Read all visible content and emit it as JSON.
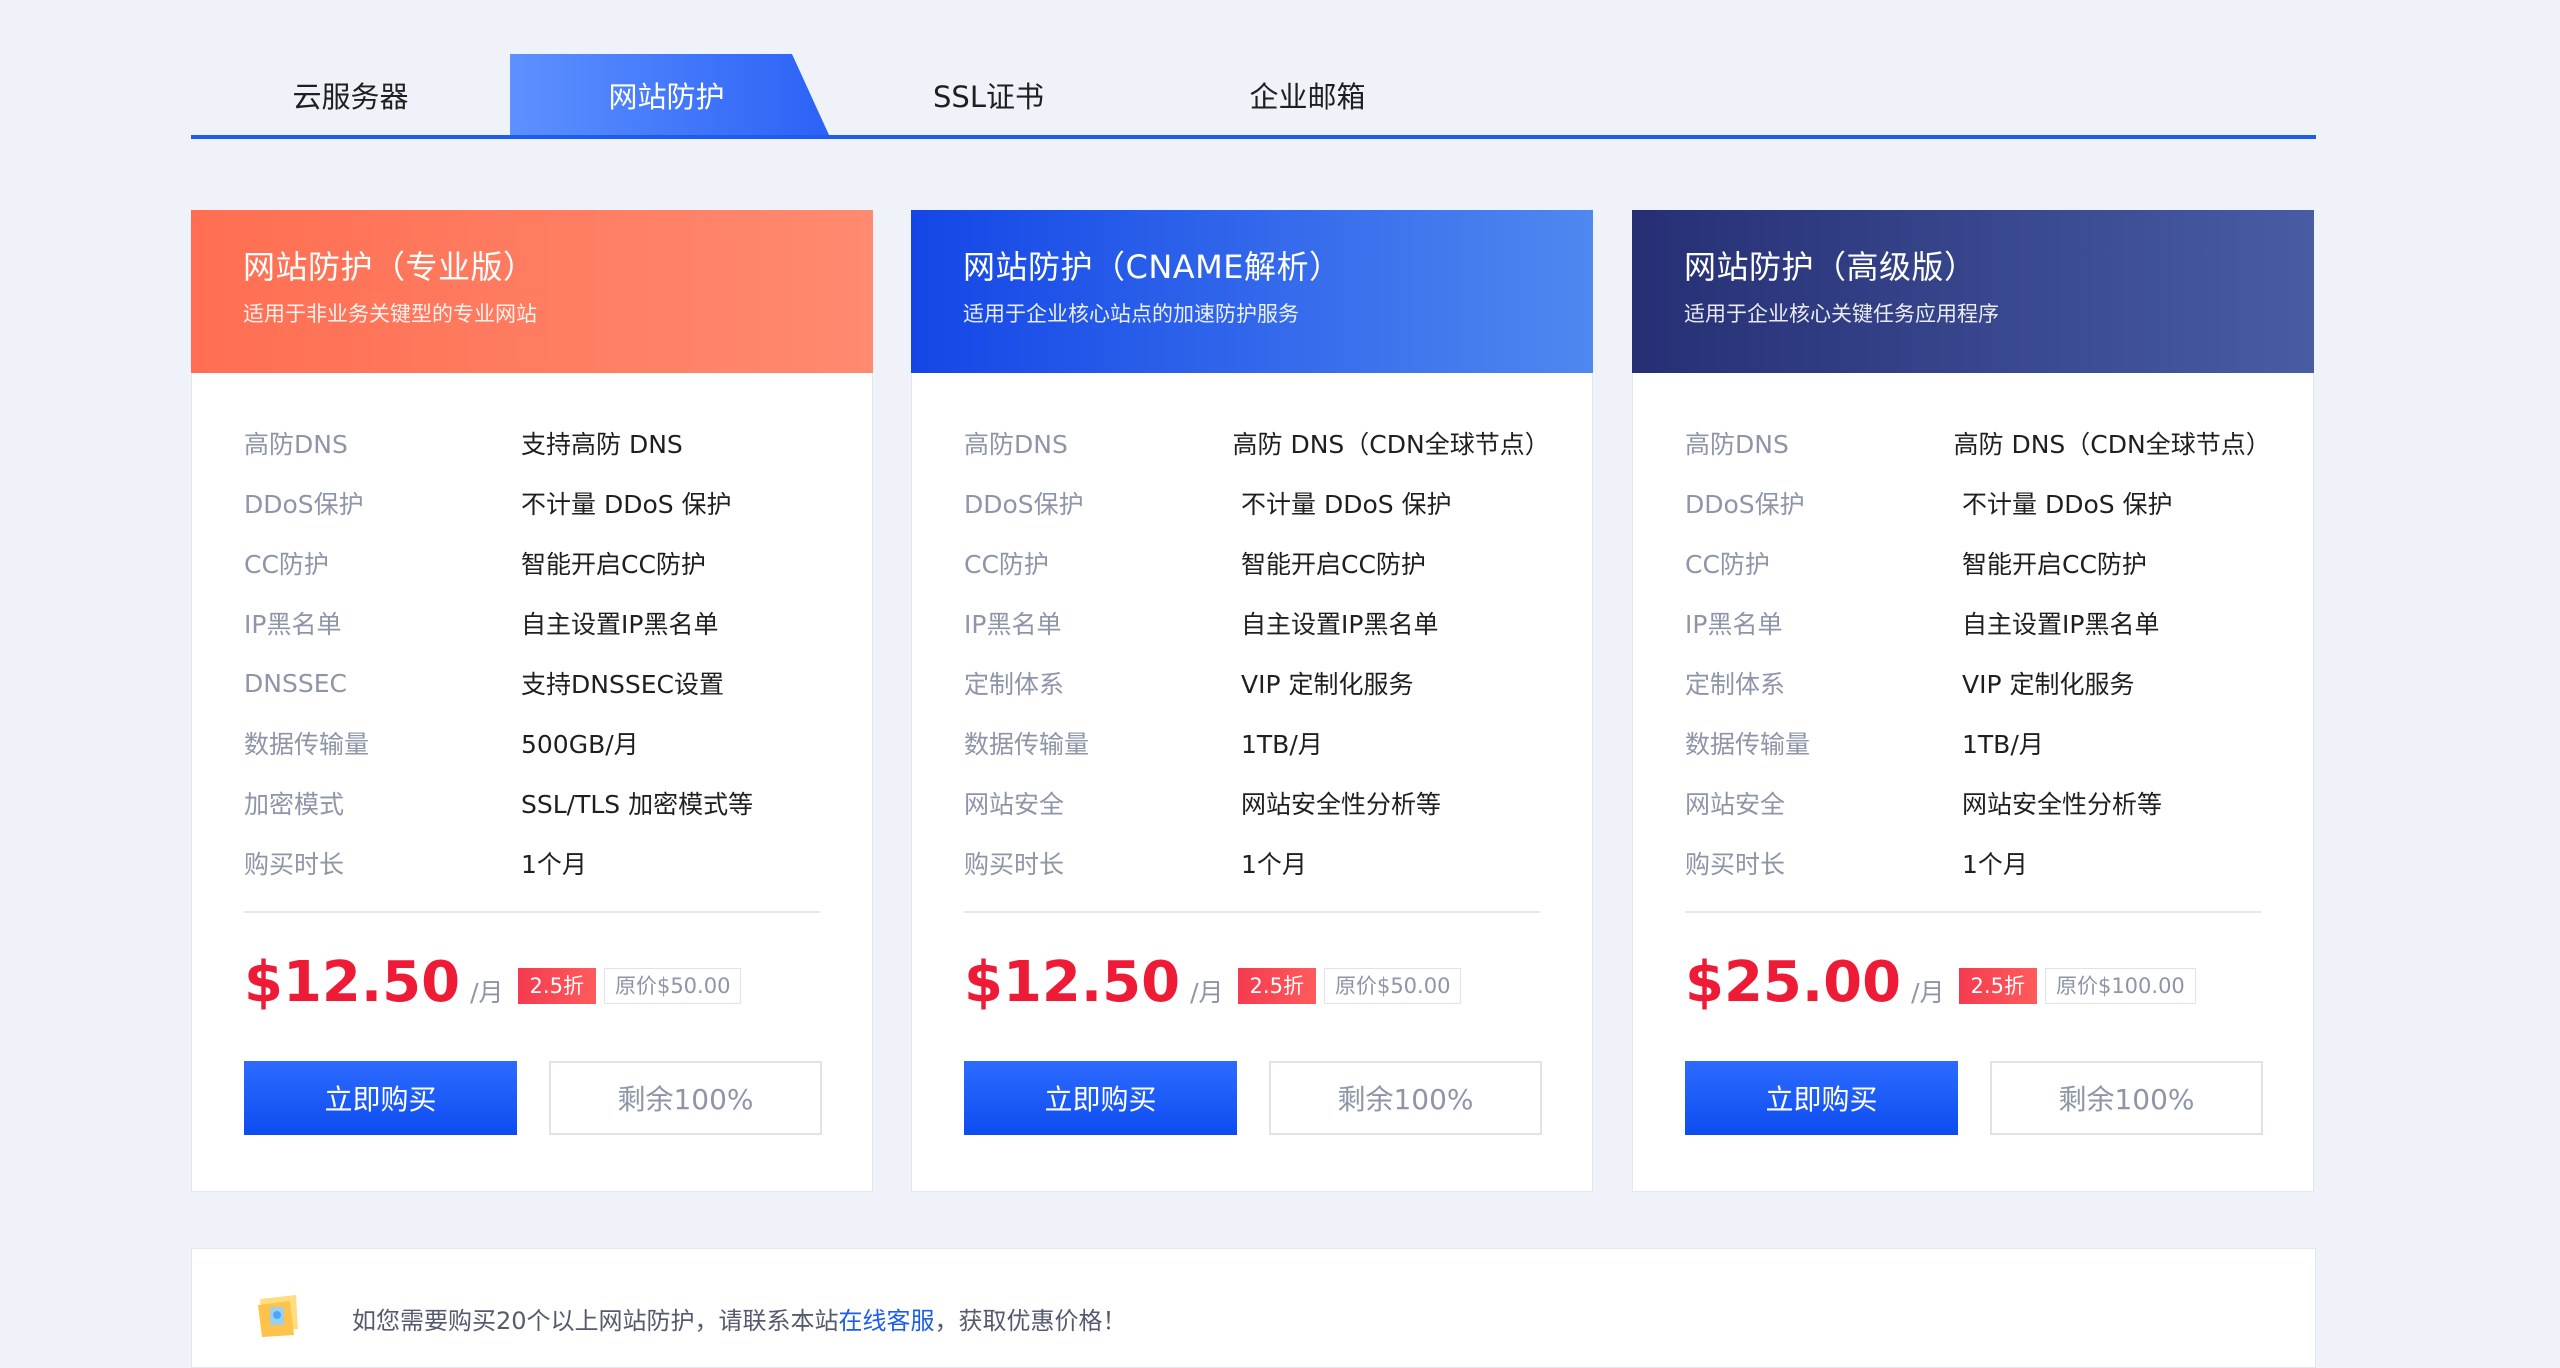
{
  "tabs": [
    {
      "label": "云服务器",
      "active": false
    },
    {
      "label": "网站防护",
      "active": true
    },
    {
      "label": "SSL证书",
      "active": false
    },
    {
      "label": "企业邮箱",
      "active": false
    }
  ],
  "colors": {
    "accent": "#1c5cf2",
    "price": "#ee1b36",
    "card0_header": "#ff6e52",
    "card1_header": "#1446e6",
    "card2_header": "#262f74"
  },
  "cards": [
    {
      "title": "网站防护（专业版）",
      "subtitle": "适用于非业务关键型的专业网站",
      "features": [
        {
          "label": "高防DNS",
          "value": "支持高防 DNS"
        },
        {
          "label": "DDoS保护",
          "value": "不计量 DDoS 保护"
        },
        {
          "label": "CC防护",
          "value": "智能开启CC防护"
        },
        {
          "label": "IP黑名单",
          "value": "自主设置IP黑名单"
        },
        {
          "label": "DNSSEC",
          "value": "支持DNSSEC设置"
        },
        {
          "label": "数据传输量",
          "value": "500GB/月"
        },
        {
          "label": "加密模式",
          "value": "SSL/TLS 加密模式等"
        },
        {
          "label": "购买时长",
          "value": "1个月"
        }
      ],
      "price": "$12.50",
      "per": "/月",
      "discount": "2.5折",
      "original": "原价$50.00",
      "buy_label": "立即购买",
      "stock_label": "剩余100%"
    },
    {
      "title": "网站防护（CNAME解析）",
      "subtitle": "适用于企业核心站点的加速防护服务",
      "features": [
        {
          "label": "高防DNS",
          "value": "高防 DNS（CDN全球节点）"
        },
        {
          "label": "DDoS保护",
          "value": "不计量 DDoS 保护"
        },
        {
          "label": "CC防护",
          "value": "智能开启CC防护"
        },
        {
          "label": "IP黑名单",
          "value": "自主设置IP黑名单"
        },
        {
          "label": "定制体系",
          "value": "VIP 定制化服务"
        },
        {
          "label": "数据传输量",
          "value": "1TB/月"
        },
        {
          "label": "网站安全",
          "value": "网站安全性分析等"
        },
        {
          "label": "购买时长",
          "value": "1个月"
        }
      ],
      "price": "$12.50",
      "per": "/月",
      "discount": "2.5折",
      "original": "原价$50.00",
      "buy_label": "立即购买",
      "stock_label": "剩余100%"
    },
    {
      "title": "网站防护（高级版）",
      "subtitle": "适用于企业核心关键任务应用程序",
      "features": [
        {
          "label": "高防DNS",
          "value": "高防 DNS（CDN全球节点）"
        },
        {
          "label": "DDoS保护",
          "value": "不计量 DDoS 保护"
        },
        {
          "label": "CC防护",
          "value": "智能开启CC防护"
        },
        {
          "label": "IP黑名单",
          "value": "自主设置IP黑名单"
        },
        {
          "label": "定制体系",
          "value": "VIP 定制化服务"
        },
        {
          "label": "数据传输量",
          "value": "1TB/月"
        },
        {
          "label": "网站安全",
          "value": "网站安全性分析等"
        },
        {
          "label": "购买时长",
          "value": "1个月"
        }
      ],
      "price": "$25.00",
      "per": "/月",
      "discount": "2.5折",
      "original": "原价$100.00",
      "buy_label": "立即购买",
      "stock_label": "剩余100%"
    }
  ],
  "notice": {
    "icon": "gift-icon",
    "text_before": "如您需要购买20个以上网站防护，请联系本站",
    "link": "在线客服",
    "text_after": "，获取优惠价格！"
  }
}
